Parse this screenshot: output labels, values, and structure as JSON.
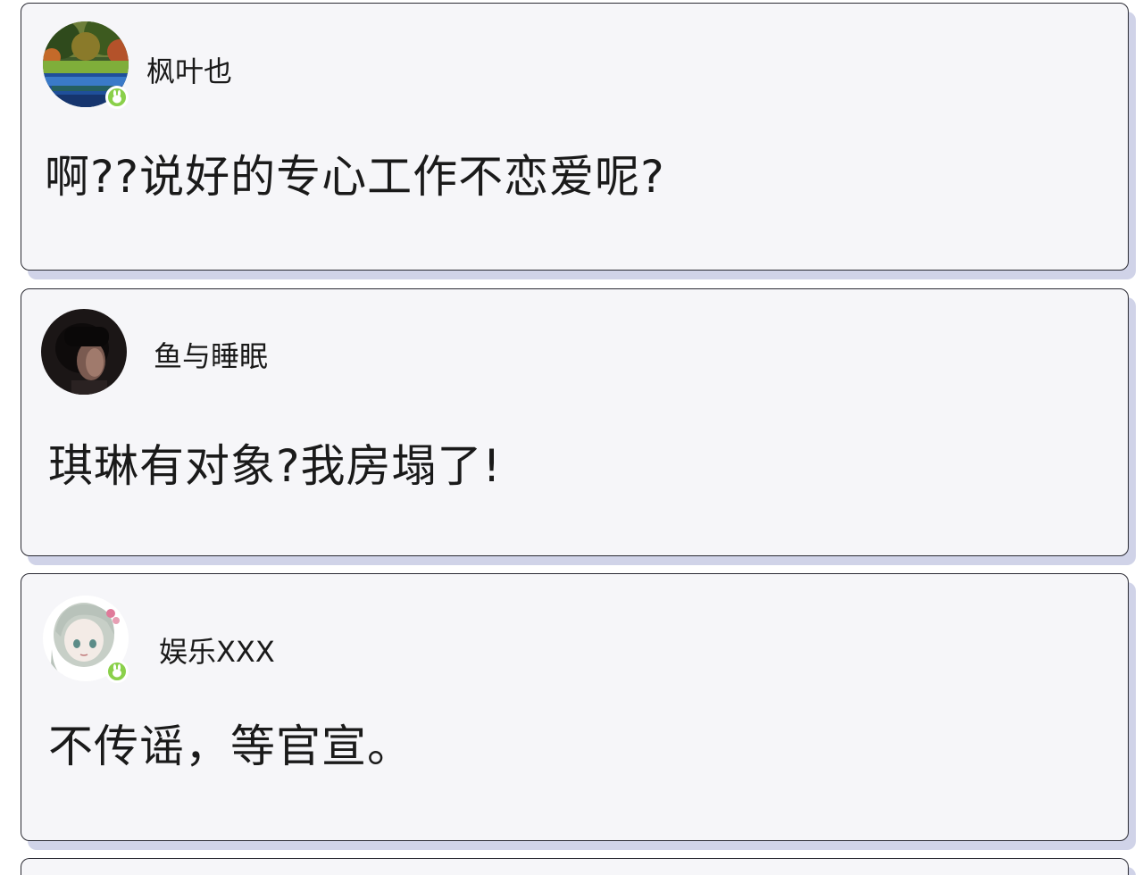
{
  "comments": [
    {
      "username": "枫叶也",
      "text": "啊??说好的专心工作不恋爱呢?",
      "avatar": "landscape-avatar",
      "verified_badge": true
    },
    {
      "username": "鱼与睡眠",
      "text": "琪琳有对象?我房塌了!",
      "avatar": "portrait-avatar",
      "verified_badge": false
    },
    {
      "username": "娱乐XXX",
      "text": "不传谣，等官宣。",
      "avatar": "anime-girl-avatar",
      "verified_badge": true
    }
  ],
  "colors": {
    "card_bg": "#f6f6f9",
    "card_border": "#2a2a33",
    "card_shadow": "#c8cbe4",
    "badge_green": "#8ad04a",
    "text": "#1a1a1a"
  }
}
